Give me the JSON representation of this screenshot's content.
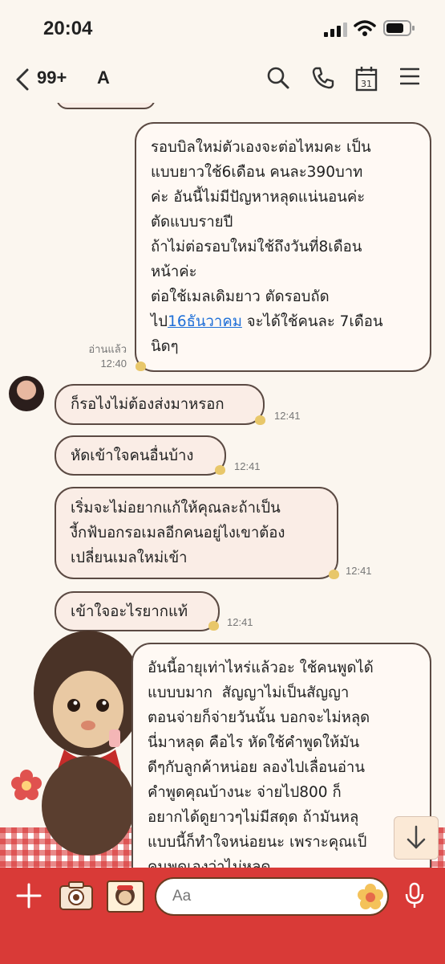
{
  "status": {
    "time": "20:04"
  },
  "header": {
    "back_count": "99+",
    "chat_name": "A"
  },
  "messages": {
    "m1": {
      "text": "รอบบิลใหม่ตัวเองจะต่อไหมคะ เป็น\nแบบยาวใช้6เดือน คนละ390บาท\nค่ะ อันนี้ไม่มีปัญหาหลุดแน่นอนค่ะ\nตัดแบบรายปี\nถ้าไม่ต่อรอบใหม่ใช้ถึงวันที่8เดือน\nหน้าค่ะ\nต่อใช้เมลเดิมยาว ตัดรอบถัด",
      "line_pre": "ไป",
      "link": "16ธันวาคม",
      "line_post": " จะได้ใช้คนละ 7เดือน\nนิดๆ",
      "read": "อ่านแล้ว",
      "time": "12:40"
    },
    "m2": {
      "text": "ก็รอไงไม่ต้องส่งมาหรอก",
      "time": "12:41"
    },
    "m3": {
      "text": "หัดเข้าใจคนอื่นบ้าง",
      "time": "12:41"
    },
    "m4": {
      "text": "เริ่มจะไม่อยากแก้ให้คุณละถ้าเป็น\nงี้กฟ้บอกรอเมลอีกคนอยู่ไงเขาต้อง\nเปลี่ยนเมลใหม่เข้า",
      "time": "12:41"
    },
    "m5": {
      "text": "เข้าใจอะไรยากแท้",
      "time": "12:41"
    },
    "m6": {
      "text": "อันนี้อายุเท่าไหร่แล้วอะ ใช้คนพูดได้\nแบบบมาก  สัญญาไม่เป็นสัญญา\nตอนจ่ายก็จ่ายวันนั้น บอกจะไม่หลุด\nนี่มาหลุด คือไร หัดใช้คำพูดให้มัน\nดีๆกับลูกค้าหน่อย ลองไปเลื่อนอ่าน\nคำพูดคุณบ้างนะ จ่ายไป800 ก็\nอยากได้ดูยาวๆไม่มีสดุด ถ้ามันหลุ\nแบบนี้ก็ทำใจหน่อยนะ เพราะคุณเป็\nคนพูดเองว่าไม่หลุด"
    }
  },
  "input": {
    "placeholder": "Aa"
  },
  "colors": {
    "bar": "#d93a37",
    "bubble_border": "#5b4a43",
    "link": "#1e6fd8"
  }
}
